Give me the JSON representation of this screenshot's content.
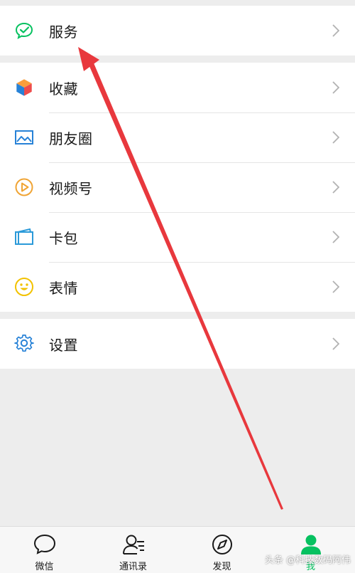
{
  "menu": {
    "services": {
      "label": "服务",
      "icon": "services-check-icon"
    },
    "group2": [
      {
        "label": "收藏",
        "icon": "favorites-cube-icon"
      },
      {
        "label": "朋友圈",
        "icon": "moments-picture-icon"
      },
      {
        "label": "视频号",
        "icon": "channels-play-icon"
      },
      {
        "label": "卡包",
        "icon": "card-wallet-icon"
      },
      {
        "label": "表情",
        "icon": "sticker-smile-icon"
      }
    ],
    "settings": {
      "label": "设置",
      "icon": "gear-icon"
    }
  },
  "tabbar": [
    {
      "label": "微信",
      "icon": "chat-bubble-icon",
      "active": false
    },
    {
      "label": "通讯录",
      "icon": "contacts-icon",
      "active": false
    },
    {
      "label": "发现",
      "icon": "compass-icon",
      "active": false
    },
    {
      "label": "我",
      "icon": "person-icon",
      "active": true
    }
  ],
  "watermark": "头条 @科技数码阿伟",
  "colors": {
    "accent_green": "#07c160",
    "arrow_red": "#e8383d",
    "background": "#ededed"
  }
}
